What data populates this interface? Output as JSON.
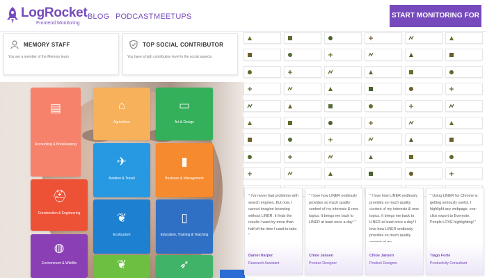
{
  "brand": {
    "name": "LogRocket",
    "tagline": "Frontend Monitoring",
    "color": "#764abc"
  },
  "nav": [
    {
      "label": "BLOG"
    },
    {
      "label": "PODCAST"
    },
    {
      "label": "MEETUPS"
    }
  ],
  "cta_label": "START MONITORING FOR FREE",
  "badges": [
    {
      "icon": "person-icon",
      "title": "MEMORY STAFF",
      "desc": "You are a member of the Memory team"
    },
    {
      "icon": "shield-icon",
      "title": "TOP SOCIAL CONTRIBUTOR",
      "desc": "You have a high contribution level to the social aspects"
    }
  ],
  "categories": [
    {
      "label": "Accounting & Bookkeeping",
      "icon": "ledger-icon",
      "color": "#f7826c"
    },
    {
      "label": "Agriculture",
      "icon": "silo-icon",
      "color": "#f6b15a"
    },
    {
      "label": "Art & Design",
      "icon": "monitor-icon",
      "color": "#34b05b"
    },
    {
      "label": "Aviation & Travel",
      "icon": "plane-icon",
      "color": "#2799e2"
    },
    {
      "label": "Business & Management",
      "icon": "chart-icon",
      "color": "#f58a2e"
    },
    {
      "label": "Construction & Engineering",
      "icon": "helmet-icon",
      "color": "#ee5236"
    },
    {
      "label": "Ecotourism",
      "icon": "leaf-icon",
      "color": "#1d80d1"
    },
    {
      "label": "Education, Training & Teaching",
      "icon": "tablet-icon",
      "color": "#2f70c4"
    },
    {
      "label": "Environment & Wildlife",
      "icon": "globe-icon",
      "color": "#8a3fb5"
    },
    {
      "label": "",
      "icon": "leaf-icon",
      "color": "#6dbf41"
    },
    {
      "label": "",
      "icon": "runner-icon",
      "color": "#40b368"
    }
  ],
  "grid": [
    [
      "",
      "",
      "",
      "",
      "",
      ""
    ],
    [
      "",
      "",
      "",
      "",
      "",
      ""
    ],
    [
      "",
      "",
      "",
      "",
      "",
      ""
    ],
    [
      "",
      "",
      "",
      "",
      "",
      ""
    ],
    [
      "",
      "",
      "",
      "",
      "",
      ""
    ],
    [
      "",
      "",
      "",
      "",
      "",
      ""
    ],
    [
      "",
      "",
      "",
      "",
      "",
      ""
    ],
    [
      "",
      "",
      "",
      "",
      "",
      ""
    ],
    [
      "",
      "",
      "",
      "",
      "",
      ""
    ],
    [
      "",
      "",
      "",
      "",
      "",
      ""
    ]
  ],
  "testimonials": [
    {
      "quote": "\" I've never had problems with search engines. But now, I cannot imagine browsing without LINER. It finds the results I want by more than half of the time I used to take. \"",
      "name": "Daniel Harper",
      "role": "Research Assistant"
    },
    {
      "quote": "\" I love how LINER endlessly provides so much quality content of my interests & new topics. It brings me back to LINER at least once a day! \"",
      "name": "Chloe Jansen",
      "role": "Product Designer"
    },
    {
      "quote": "\" I love how LINER endlessly provides so much quality content of my interests & new topics. It brings me back to LINER at least once a day! I love how LINER endlessly provides so much quality content of my",
      "name": "Chloe Jansen",
      "role": "Product Designer"
    },
    {
      "quote": "\" Using LINER for Chrome is getting seriously useful. I highlight any webpage, one-click export to Evernote. People LOVE highlighting! \"",
      "name": "Tiago Forte",
      "role": "Productivity Consultant"
    }
  ],
  "tiny_button": ""
}
